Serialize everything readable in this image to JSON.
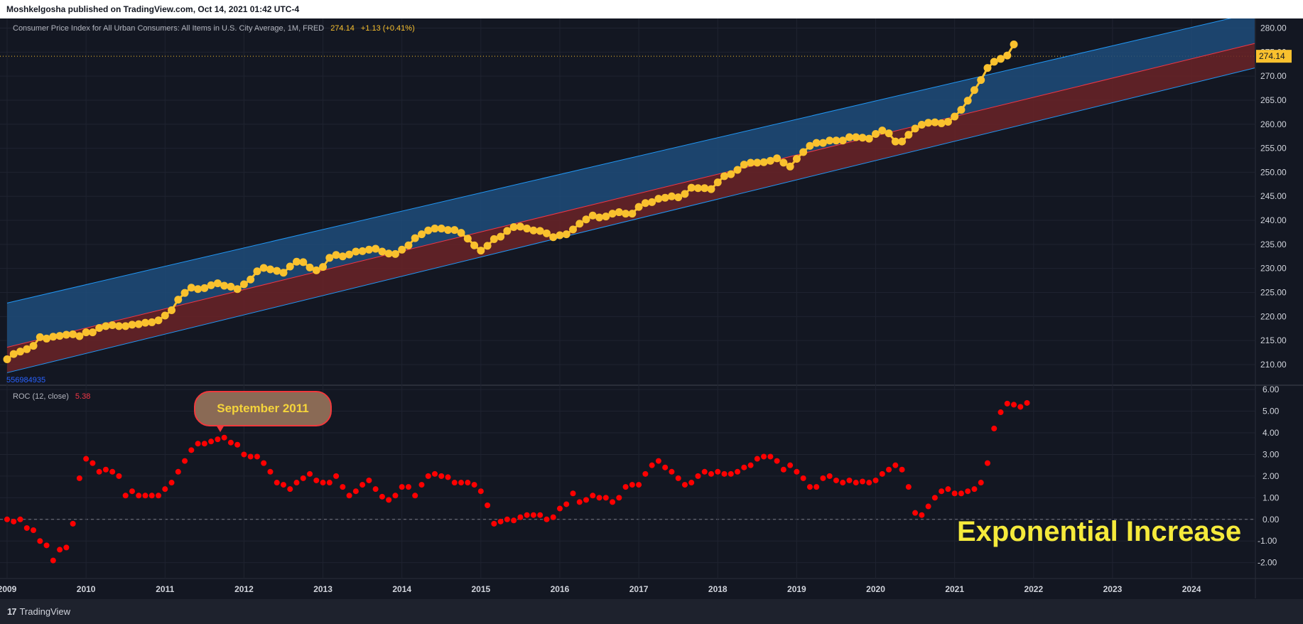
{
  "header": {
    "text": "Moshkelgosha published on TradingView.com, Oct 14, 2021 01:42 UTC-4"
  },
  "legend": {
    "title": "Consumer Price Index for All Urban Consumers: All Items in U.S. City Average, 1M, FRED",
    "value": "274.14",
    "change": "+1.13 (+0.41%)"
  },
  "id_label": "556984935",
  "roc_legend": {
    "title": "ROC (12, close)",
    "value": "5.38"
  },
  "annotations": {
    "callout": "September 2011",
    "note": "Exponential Increase"
  },
  "price_tag": "274.14",
  "footer": {
    "logo": "17",
    "brand": "TradingView"
  },
  "colors": {
    "background": "#131722",
    "cpi": "#f9c12e",
    "roc": "#ff0000",
    "channel_upper": "#1e4c7a",
    "channel_lower": "#6b2327",
    "channel_line": "#2196f3"
  },
  "chart_data": [
    {
      "type": "scatter",
      "title": "Consumer Price Index for All Urban Consumers: All Items in U.S. City Average, 1M, FRED",
      "x_ticks": [
        "2009",
        "2010",
        "2011",
        "2012",
        "2013",
        "2014",
        "2015",
        "2016",
        "2017",
        "2018",
        "2019",
        "2020",
        "2021",
        "2022",
        "2023",
        "2024"
      ],
      "y_ticks": [
        "210.00",
        "215.00",
        "220.00",
        "225.00",
        "230.00",
        "235.00",
        "240.00",
        "245.00",
        "250.00",
        "255.00",
        "260.00",
        "265.00",
        "270.00",
        "275.00",
        "280.00"
      ],
      "ylim": [
        206,
        282
      ],
      "xlim": [
        2009.0,
        2024.8
      ],
      "series": [
        {
          "x_start": 2009.0,
          "x_step": 0.083333,
          "values": [
            211.1,
            212.2,
            212.7,
            213.2,
            213.9,
            215.7,
            215.4,
            215.8,
            215.97,
            216.2,
            216.3,
            215.9,
            216.7,
            216.7,
            217.6,
            218.0,
            218.2,
            218.0,
            218.0,
            218.3,
            218.4,
            218.7,
            218.8,
            219.2,
            220.2,
            221.3,
            223.5,
            224.9,
            226.0,
            225.7,
            225.9,
            226.5,
            226.9,
            226.4,
            226.2,
            225.7,
            226.7,
            227.7,
            229.4,
            230.1,
            229.8,
            229.5,
            229.1,
            230.4,
            231.4,
            231.3,
            230.2,
            229.6,
            230.3,
            232.2,
            232.8,
            232.5,
            232.9,
            233.5,
            233.6,
            233.9,
            234.1,
            233.5,
            233.1,
            233.0,
            233.9,
            234.8,
            236.3,
            237.1,
            237.9,
            238.3,
            238.3,
            238.0,
            238.0,
            237.4,
            236.2,
            234.8,
            233.7,
            234.7,
            236.1,
            236.6,
            237.8,
            238.6,
            238.7,
            238.3,
            237.9,
            237.8,
            237.3,
            236.5,
            236.9,
            237.1,
            238.1,
            239.3,
            240.2,
            241.0,
            240.6,
            240.8,
            241.4,
            241.7,
            241.4,
            241.4,
            242.8,
            243.6,
            243.8,
            244.5,
            244.7,
            245.0,
            244.8,
            245.5,
            246.8,
            246.7,
            246.7,
            246.5,
            247.9,
            249.2,
            249.6,
            250.5,
            251.6,
            251.99,
            252.0,
            252.1,
            252.4,
            252.9,
            252.0,
            251.2,
            252.8,
            254.2,
            255.5,
            256.1,
            256.1,
            256.6,
            256.6,
            256.6,
            257.3,
            257.3,
            257.2,
            257.0,
            257.97,
            258.7,
            258.1,
            256.4,
            256.4,
            257.8,
            259.1,
            259.9,
            260.3,
            260.4,
            260.2,
            260.5,
            261.6,
            263.0,
            264.9,
            267.1,
            269.2,
            271.7,
            273.0,
            273.6,
            274.3,
            276.6
          ],
          "name": ""
        }
      ],
      "channel": {
        "upper": [
          [
            2009.0,
            222.8
          ],
          [
            2024.8,
            283.2
          ]
        ],
        "middle": [
          [
            2009.0,
            213.6
          ],
          [
            2024.8,
            276.8
          ]
        ],
        "lower": [
          [
            2009.0,
            208.3
          ],
          [
            2024.8,
            271.7
          ]
        ]
      },
      "last_value": 274.14
    },
    {
      "type": "scatter",
      "title": "ROC (12, close)",
      "x_ticks": [
        "2009",
        "2010",
        "2011",
        "2012",
        "2013",
        "2014",
        "2015",
        "2016",
        "2017",
        "2018",
        "2019",
        "2020",
        "2021",
        "2022",
        "2023",
        "2024"
      ],
      "y_ticks": [
        "-2.00",
        "-1.00",
        "0.00",
        "1.00",
        "2.00",
        "3.00",
        "4.00",
        "5.00",
        "6.00"
      ],
      "ylim": [
        -2.7,
        6.2
      ],
      "xlim": [
        2009.0,
        2024.8
      ],
      "series": [
        {
          "x_start": 2009.0,
          "x_step": 0.083333,
          "values": [
            0.0,
            -0.1,
            0.0,
            -0.4,
            -0.5,
            -1.0,
            -1.2,
            -1.9,
            -1.4,
            -1.3,
            -0.2,
            1.9,
            2.8,
            2.6,
            2.2,
            2.3,
            2.2,
            2.0,
            1.1,
            1.3,
            1.1,
            1.1,
            1.1,
            1.1,
            1.4,
            1.7,
            2.2,
            2.7,
            3.2,
            3.5,
            3.5,
            3.6,
            3.7,
            3.78,
            3.55,
            3.45,
            3.0,
            2.9,
            2.9,
            2.6,
            2.2,
            1.7,
            1.6,
            1.4,
            1.7,
            1.9,
            2.1,
            1.8,
            1.7,
            1.7,
            2.0,
            1.5,
            1.1,
            1.3,
            1.6,
            1.8,
            1.4,
            1.05,
            0.9,
            1.1,
            1.5,
            1.5,
            1.1,
            1.6,
            2.0,
            2.1,
            2.0,
            1.95,
            1.7,
            1.7,
            1.7,
            1.6,
            1.3,
            0.65,
            -0.2,
            -0.1,
            0.0,
            -0.05,
            0.1,
            0.2,
            0.2,
            0.2,
            0.0,
            0.1,
            0.5,
            0.7,
            1.2,
            0.8,
            0.9,
            1.1,
            1.0,
            1.0,
            0.8,
            1.0,
            1.5,
            1.6,
            1.6,
            2.1,
            2.5,
            2.7,
            2.4,
            2.2,
            1.9,
            1.6,
            1.7,
            2.0,
            2.2,
            2.1,
            2.2,
            2.1,
            2.1,
            2.2,
            2.4,
            2.5,
            2.8,
            2.9,
            2.9,
            2.7,
            2.3,
            2.5,
            2.2,
            1.9,
            1.5,
            1.5,
            1.9,
            2.0,
            1.8,
            1.7,
            1.8,
            1.7,
            1.75,
            1.7,
            1.8,
            2.1,
            2.3,
            2.5,
            2.3,
            1.5,
            0.3,
            0.2,
            0.6,
            1.0,
            1.3,
            1.4,
            1.2,
            1.2,
            1.3,
            1.4,
            1.7,
            2.6,
            4.2,
            4.95,
            5.35,
            5.3,
            5.2,
            5.38
          ],
          "name": ""
        }
      ],
      "last_value": 5.38
    }
  ]
}
